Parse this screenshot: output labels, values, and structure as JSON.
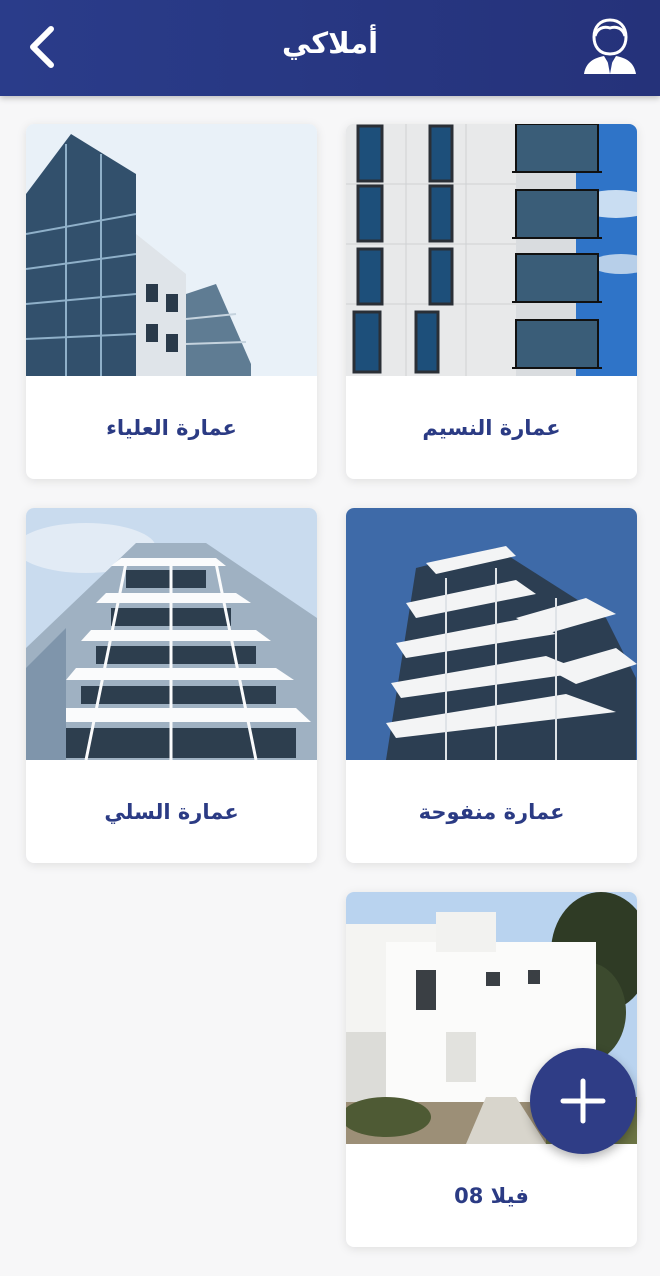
{
  "header": {
    "title": "أملاكي",
    "back_icon": "chevron-left-icon",
    "profile_icon": "user-profile-icon"
  },
  "properties": [
    {
      "name": "عمارة النسيم"
    },
    {
      "name": "عمارة العلياء"
    },
    {
      "name": "عمارة منفوحة"
    },
    {
      "name": "عمارة السلي"
    },
    {
      "name": "فيلا  08"
    }
  ],
  "fab": {
    "icon": "plus-icon"
  },
  "colors": {
    "header": "#2a3c8a",
    "accent_text": "#2b3b84",
    "fab": "#2f3d86",
    "background": "#f7f7f8"
  }
}
